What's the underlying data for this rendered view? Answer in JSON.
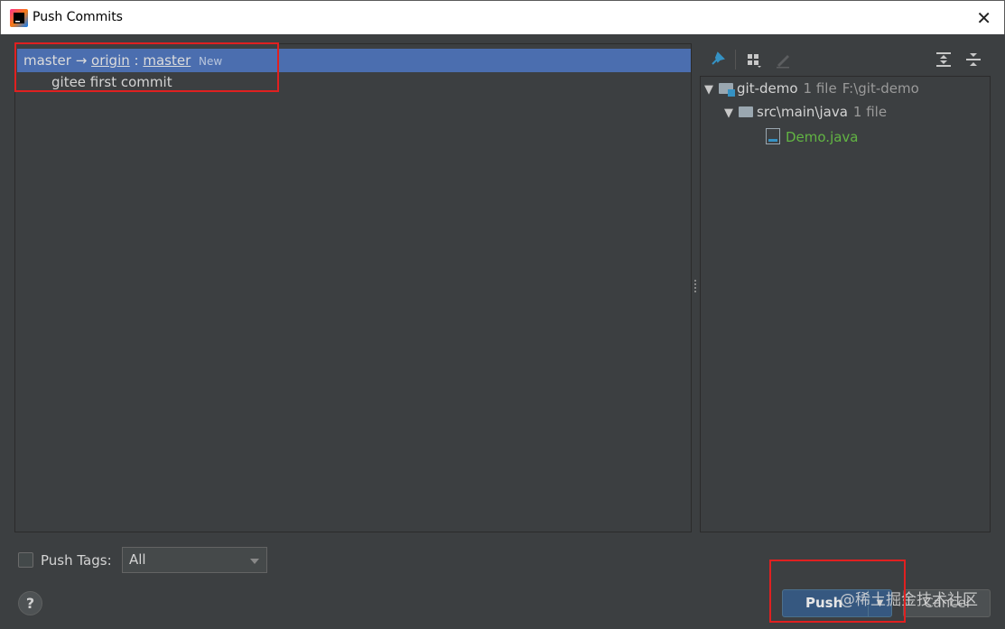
{
  "window": {
    "title": "Push Commits",
    "close_icon": "close-icon"
  },
  "branch": {
    "local": "master",
    "arrow": "→",
    "remote": "origin",
    "sep": " : ",
    "remote_branch": "master",
    "badge": "New",
    "selected_color": "#4b6eaf"
  },
  "commits": [
    "gitee first commit"
  ],
  "tree": {
    "root": {
      "name": "git-demo",
      "files": "1 file",
      "path": "F:\\git-demo"
    },
    "folder": {
      "name": "src\\main\\java",
      "files": "1 file"
    },
    "file": {
      "name": "Demo.java",
      "color": "#62b543"
    }
  },
  "toolbar": [
    "pin-icon",
    "group-by-icon",
    "edit-icon",
    "expand-all-icon",
    "collapse-all-icon"
  ],
  "footer": {
    "push_tags_label": "Push Tags:",
    "push_tags_checked": false,
    "tags_select": "All",
    "help": "?",
    "push_label": "Push",
    "cancel_label": "Cancel",
    "watermark": "@稀土掘金技术社区"
  }
}
